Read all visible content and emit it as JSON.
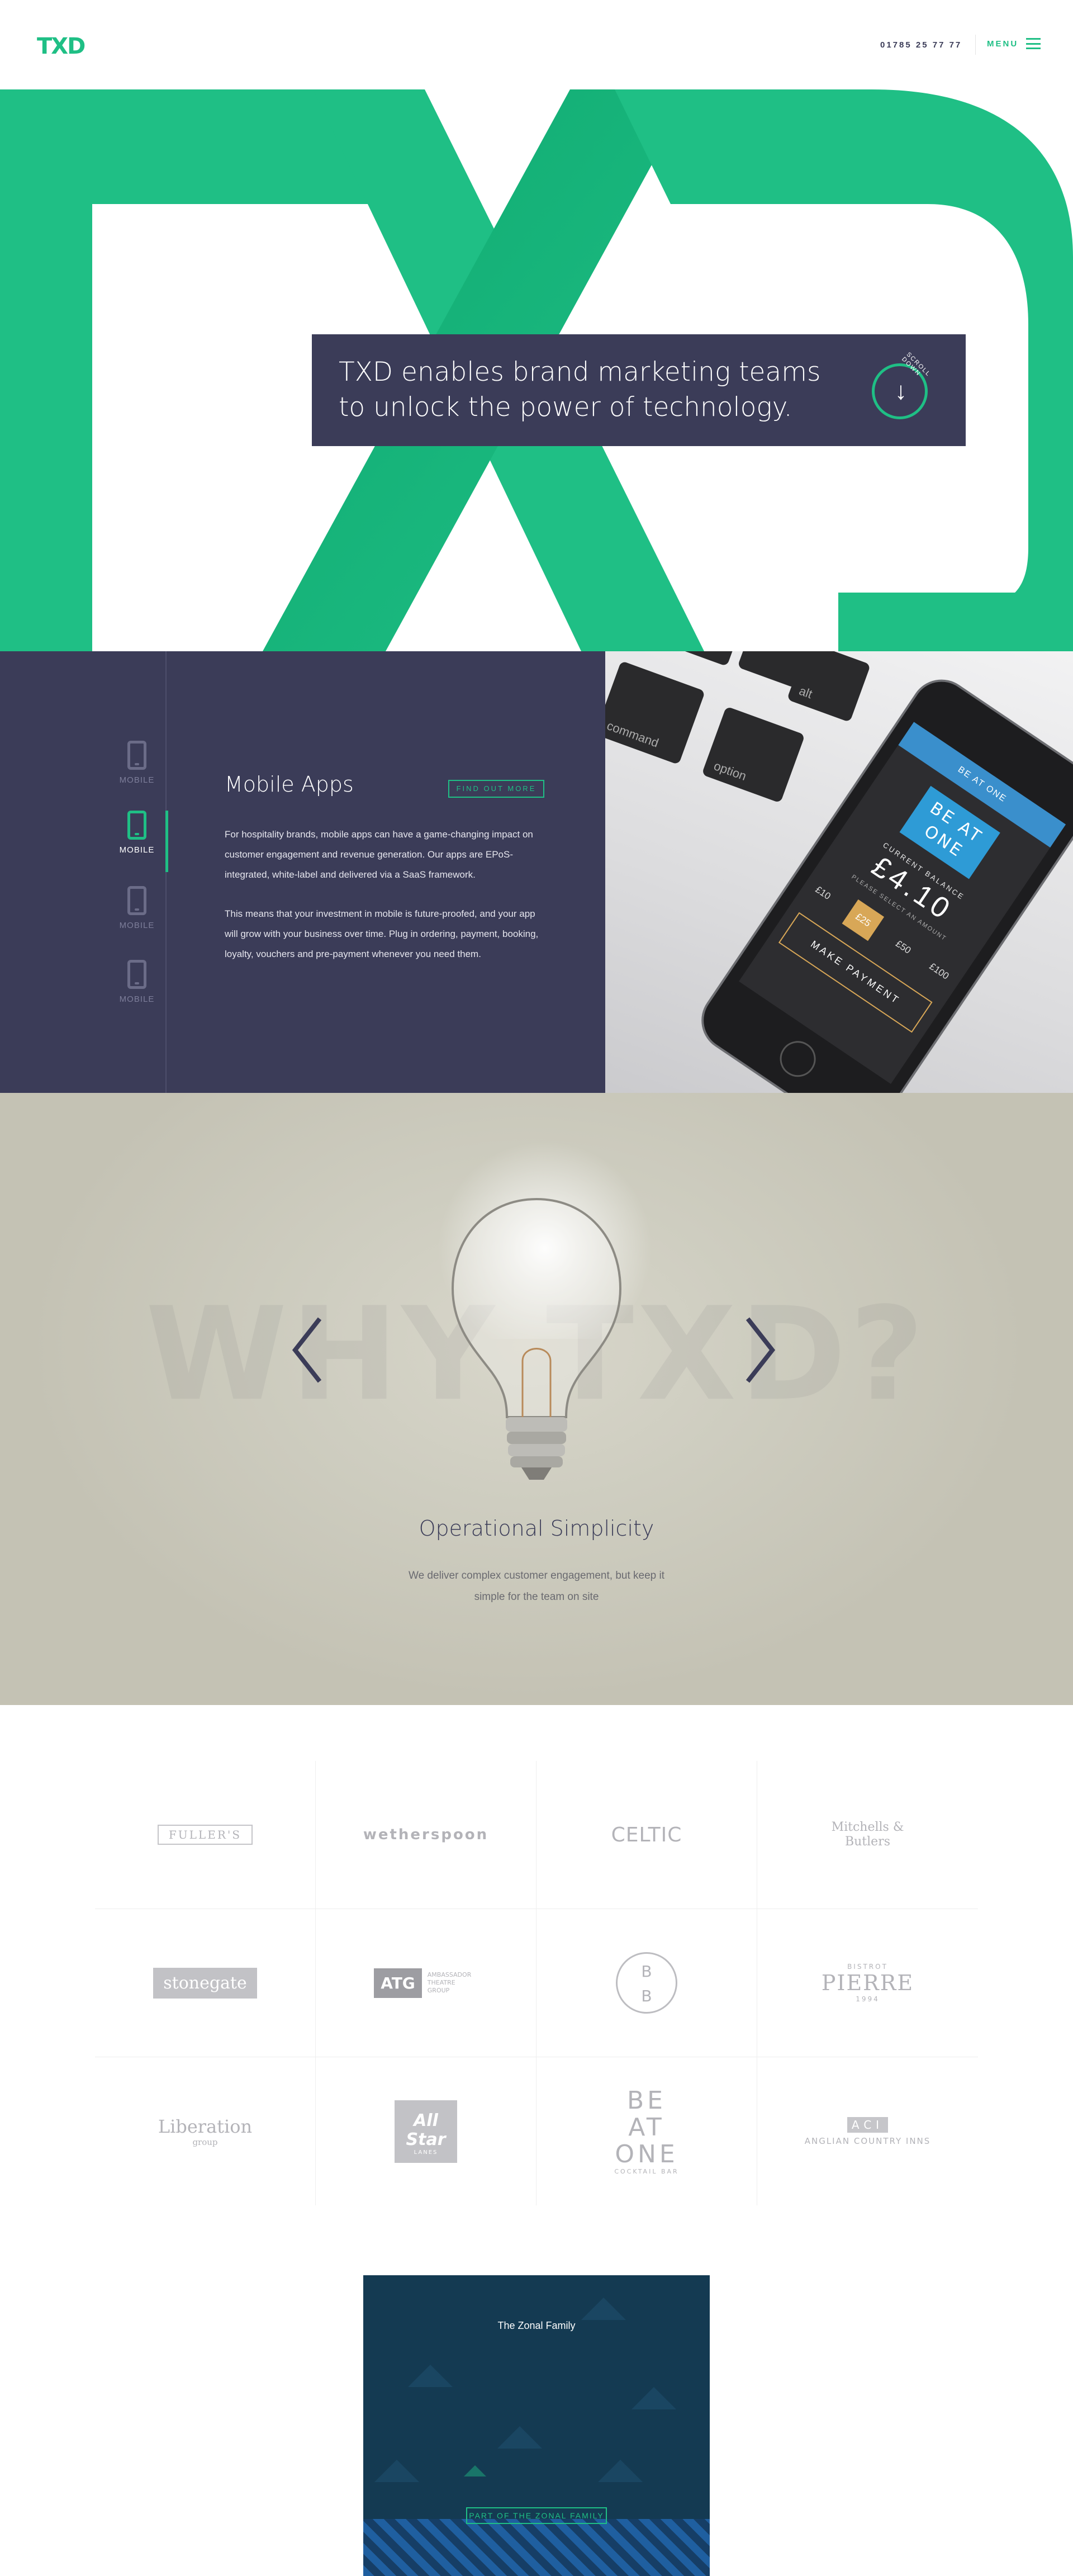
{
  "header": {
    "logo": "TXD",
    "phone": "01785 25 77 77",
    "menu_label": "MENU"
  },
  "hero": {
    "headline": "TXD enables brand marketing teams to unlock the power of technology.",
    "scroll_label": "SCROLL DOWN",
    "colors": {
      "brand_green": "#1fbf85",
      "navy": "#3b3c58"
    }
  },
  "product": {
    "tabs": [
      {
        "label": "MOBILE",
        "active": false
      },
      {
        "label": "MOBILE",
        "active": true
      },
      {
        "label": "MOBILE",
        "active": false
      },
      {
        "label": "MOBILE",
        "active": false
      }
    ],
    "title": "Mobile Apps",
    "cta": "FIND OUT MORE",
    "paragraphs": [
      "For hospitality brands, mobile apps can have a game-changing impact on customer engagement and revenue generation. Our apps are EPoS-integrated, white-label and delivered via a SaaS framework.",
      "This means that your investment in mobile is future-proofed, and your app will grow with your business over time. Plug in ordering, payment, booking, loyalty, vouchers and pre-payment whenever you need them."
    ],
    "phone_mock": {
      "app_bar": "BE AT ONE",
      "logo": "BE AT ONE",
      "balance_label": "CURRENT BALANCE",
      "balance": "£4.10",
      "select_label": "PLEASE SELECT AN AMOUNT",
      "amounts": [
        "£10",
        "£25",
        "£50",
        "£100"
      ],
      "selected_amount": "£25",
      "pay_button": "MAKE PAYMENT"
    },
    "keys": [
      "command",
      "option",
      "alt"
    ]
  },
  "why": {
    "background_word": "WHY TXD?",
    "title": "Operational Simplicity",
    "subtitle": "We deliver complex customer engagement, but keep it simple for the team on site"
  },
  "clients": [
    {
      "name": "FULLER'S"
    },
    {
      "name": "wetherspoon"
    },
    {
      "name": "CELTIC"
    },
    {
      "name": "Mitchells & Butlers"
    },
    {
      "name": "stonegate"
    },
    {
      "name": "AMBASSADOR THEATRE GROUP",
      "mark": "ATG"
    },
    {
      "name": "B B"
    },
    {
      "name": "PIERRE",
      "top": "BISTROT",
      "bottom": "1994"
    },
    {
      "name": "Liberation",
      "sub": "group"
    },
    {
      "name": "All Star",
      "sub": "LANES"
    },
    {
      "name": "BE AT ONE",
      "sub": "COCKTAIL BAR"
    },
    {
      "name": "ANGLIAN COUNTRY INNS",
      "mark": "ACI"
    }
  ],
  "zonal": {
    "title": "The Zonal Family",
    "badge": "PART OF THE ZONAL FAMILY"
  }
}
